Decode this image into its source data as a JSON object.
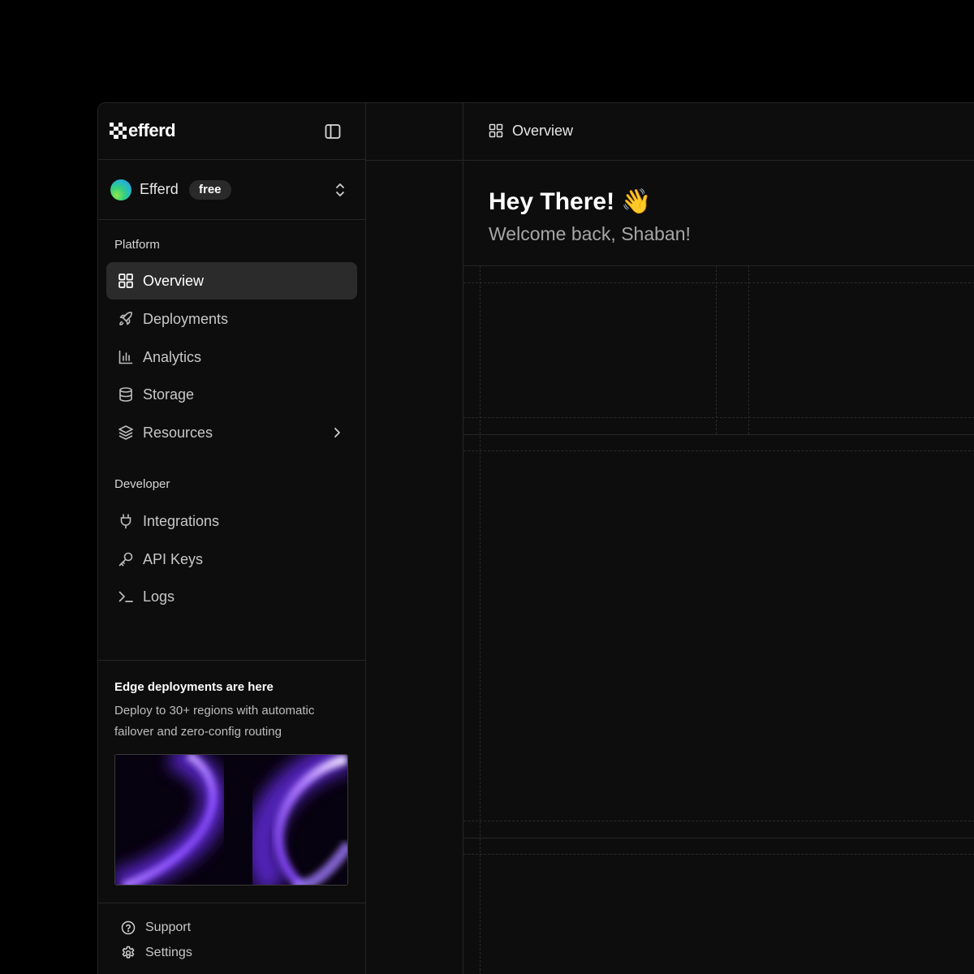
{
  "brand": {
    "logo_text": "efferd"
  },
  "workspace": {
    "name": "Efferd",
    "plan_badge": "free"
  },
  "nav": {
    "platform_label": "Platform",
    "platform_items": [
      {
        "label": "Overview",
        "icon": "grid-icon",
        "active": true
      },
      {
        "label": "Deployments",
        "icon": "rocket-icon"
      },
      {
        "label": "Analytics",
        "icon": "bar-chart-icon"
      },
      {
        "label": "Storage",
        "icon": "database-icon"
      },
      {
        "label": "Resources",
        "icon": "layers-icon",
        "has_submenu": true
      }
    ],
    "developer_label": "Developer",
    "developer_items": [
      {
        "label": "Integrations",
        "icon": "plug-icon"
      },
      {
        "label": "API Keys",
        "icon": "key-icon"
      },
      {
        "label": "Logs",
        "icon": "terminal-icon"
      }
    ]
  },
  "promo": {
    "title": "Edge deployments are here",
    "description": "Deploy to 30+ regions with automatic failover and zero-config routing"
  },
  "footer": {
    "support_label": "Support",
    "settings_label": "Settings"
  },
  "header": {
    "breadcrumb_label": "Overview"
  },
  "greeting": {
    "title": "Hey There! 👋",
    "subtitle": "Welcome back, Shaban!"
  },
  "colors": {
    "background": "#000000",
    "panel": "#0d0d0d",
    "border": "#262626",
    "active_item": "#2b2b2b",
    "accent_purple": "#9b6bff"
  }
}
